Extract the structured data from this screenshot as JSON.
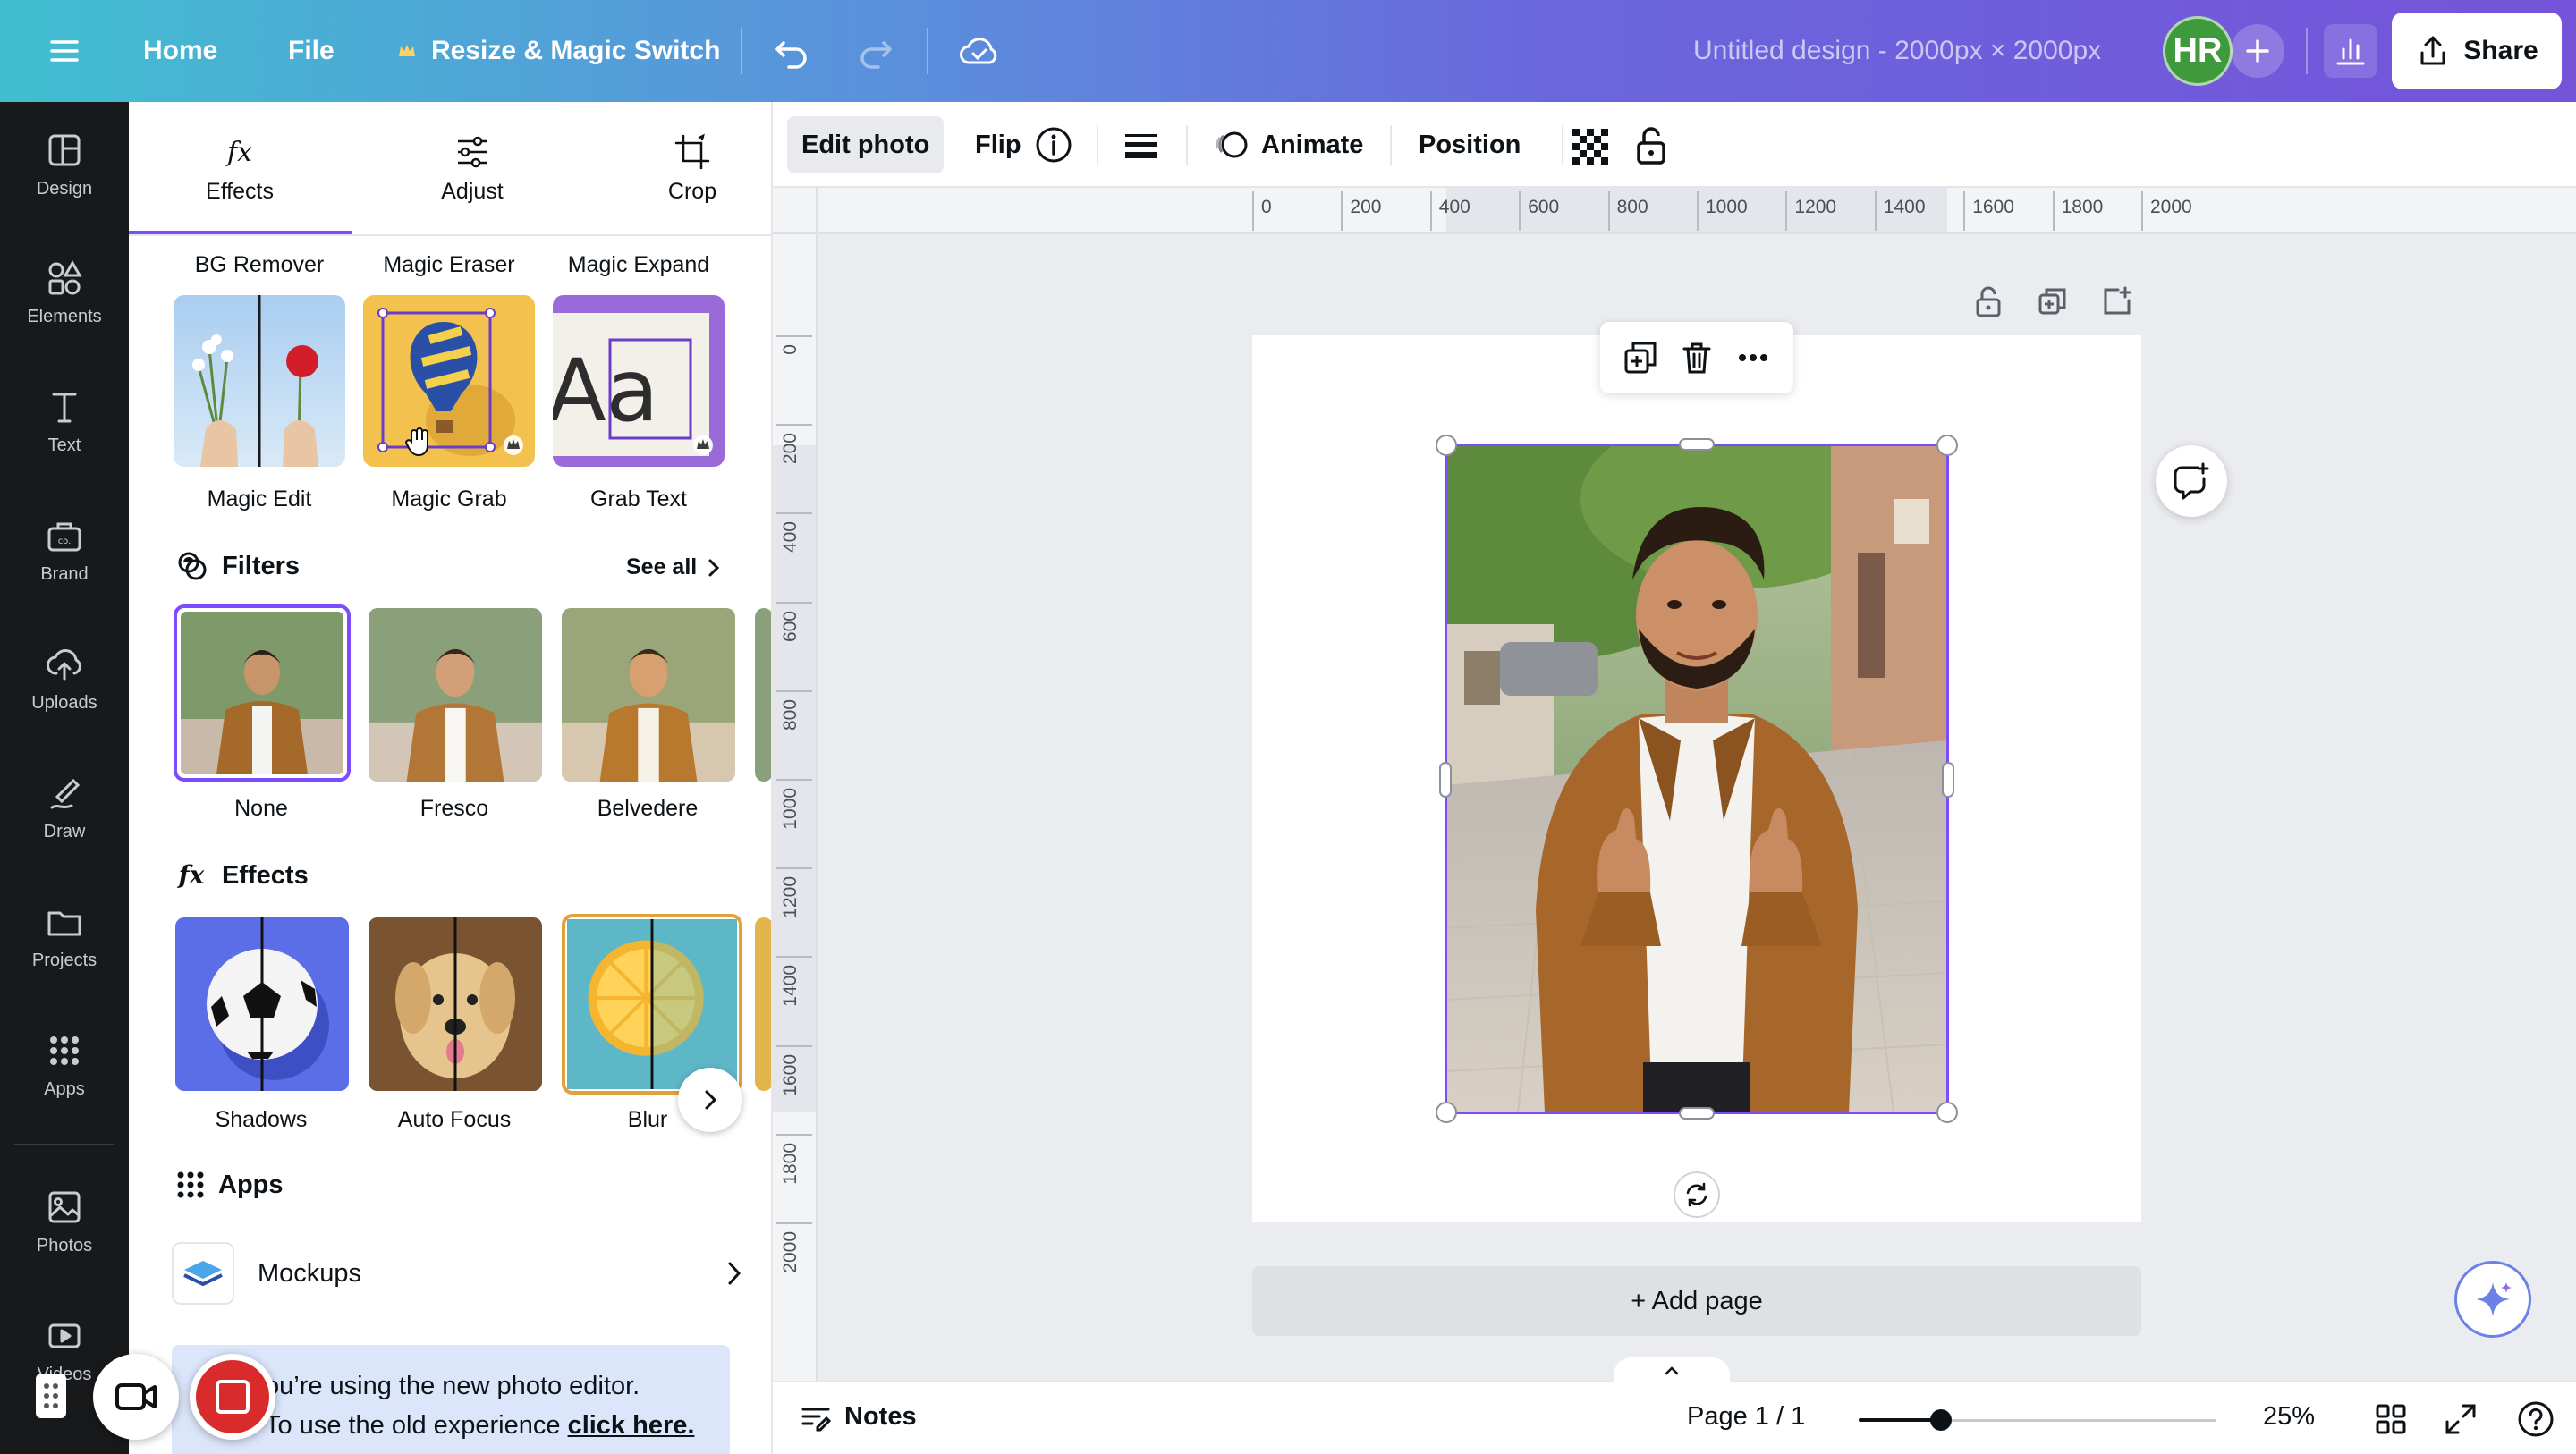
{
  "topbar": {
    "home": "Home",
    "file": "File",
    "resize": "Resize & Magic Switch",
    "doc_title": "Untitled design - 2000px × 2000px",
    "avatar_initials": "HR",
    "share": "Share"
  },
  "leftnav": {
    "items": [
      {
        "label": "Design",
        "icon": "design-icon"
      },
      {
        "label": "Elements",
        "icon": "elements-icon"
      },
      {
        "label": "Text",
        "icon": "text-icon"
      },
      {
        "label": "Brand",
        "icon": "brand-icon"
      },
      {
        "label": "Uploads",
        "icon": "uploads-icon"
      },
      {
        "label": "Draw",
        "icon": "draw-icon"
      },
      {
        "label": "Projects",
        "icon": "projects-icon"
      },
      {
        "label": "Apps",
        "icon": "apps-icon"
      },
      {
        "label": "Photos",
        "icon": "photos-icon"
      },
      {
        "label": "Videos",
        "icon": "videos-icon"
      }
    ]
  },
  "panel": {
    "tabs": [
      {
        "label": "Effects",
        "icon": "fx-icon"
      },
      {
        "label": "Adjust",
        "icon": "sliders-icon"
      },
      {
        "label": "Crop",
        "icon": "crop-icon"
      }
    ],
    "tools_top": [
      "BG Remover",
      "Magic Eraser",
      "Magic Expand"
    ],
    "tools": [
      "Magic Edit",
      "Magic Grab",
      "Grab Text"
    ],
    "filters": {
      "title": "Filters",
      "see_all": "See all",
      "items": [
        "None",
        "Fresco",
        "Belvedere"
      ]
    },
    "effects": {
      "title": "Effects",
      "items": [
        "Shadows",
        "Auto Focus",
        "Blur"
      ]
    },
    "apps": {
      "title": "Apps",
      "mockups": "Mockups"
    },
    "notice": {
      "line1": "ou’re using the new photo editor.",
      "line2": "To use the old experience ",
      "link": "click here."
    }
  },
  "ctxbar": {
    "edit_photo": "Edit photo",
    "flip": "Flip",
    "animate": "Animate",
    "position": "Position"
  },
  "ruler": {
    "h_ticks": [
      "0",
      "200",
      "400",
      "600",
      "800",
      "1000",
      "1200",
      "1400",
      "1600",
      "1800",
      "2000"
    ],
    "v_ticks": [
      "0",
      "200",
      "400",
      "600",
      "800",
      "1000",
      "1200",
      "1400",
      "1600",
      "1800",
      "2000"
    ]
  },
  "canvas": {
    "add_page": "+ Add page"
  },
  "bottombar": {
    "notes": "Notes",
    "page": "Page 1 / 1",
    "zoom": "25%",
    "zoom_fraction": 0.23
  },
  "colors": {
    "accent": "#7c4dff",
    "record": "#d92b2b"
  }
}
